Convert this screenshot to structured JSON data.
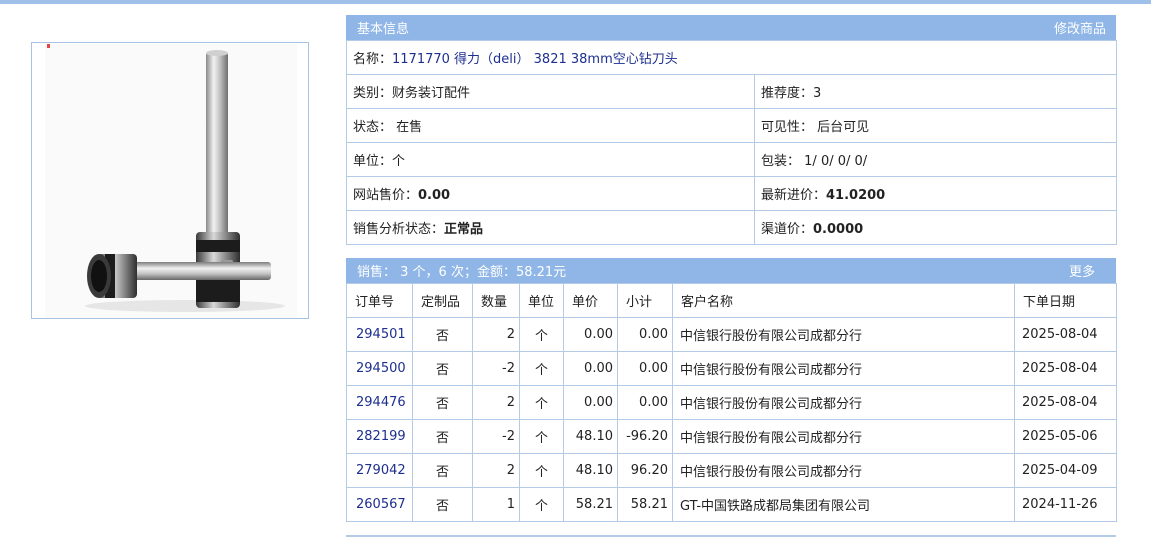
{
  "info": {
    "title": "基本信息",
    "edit_label": "修改商品",
    "name_label": "名称：",
    "name_value": "1171770 得力（deli） 3821 38mm空心钻刀头",
    "category_label": "类别：",
    "category_value": "财务装订配件",
    "recommend_label": "推荐度：",
    "recommend_value": "3",
    "status_label": "状态：",
    "status_value": "在售",
    "visibility_label": "可见性：",
    "visibility_value": "后台可见",
    "unit_label": "单位：",
    "unit_value": "个",
    "package_label": "包装：",
    "package_value": "1/ 0/ 0/ 0/",
    "site_price_label": "网站售价：",
    "site_price_value": "0.00",
    "latest_cost_label": "最新进价：",
    "latest_cost_value": "41.0200",
    "sales_status_label": "销售分析状态：",
    "sales_status_value": "正常品",
    "channel_price_label": "渠道价：",
    "channel_price_value": "0.0000"
  },
  "sales": {
    "summary": "销售： 3 个，6 次；金额：58.21元",
    "more_label": "更多",
    "headers": [
      "订单号",
      "定制品",
      "数量",
      "单位",
      "单价",
      "小计",
      "客户名称",
      "下单日期"
    ],
    "rows": [
      {
        "order": "294501",
        "custom": "否",
        "qty": "2",
        "unit": "个",
        "price": "0.00",
        "subtotal": "0.00",
        "customer": "中信银行股份有限公司成都分行",
        "date": "2025-08-04"
      },
      {
        "order": "294500",
        "custom": "否",
        "qty": "-2",
        "unit": "个",
        "price": "0.00",
        "subtotal": "0.00",
        "customer": "中信银行股份有限公司成都分行",
        "date": "2025-08-04"
      },
      {
        "order": "294476",
        "custom": "否",
        "qty": "2",
        "unit": "个",
        "price": "0.00",
        "subtotal": "0.00",
        "customer": "中信银行股份有限公司成都分行",
        "date": "2025-08-04"
      },
      {
        "order": "282199",
        "custom": "否",
        "qty": "-2",
        "unit": "个",
        "price": "48.10",
        "subtotal": "-96.20",
        "customer": "中信银行股份有限公司成都分行",
        "date": "2025-05-06"
      },
      {
        "order": "279042",
        "custom": "否",
        "qty": "2",
        "unit": "个",
        "price": "48.10",
        "subtotal": "96.20",
        "customer": "中信银行股份有限公司成都分行",
        "date": "2025-04-09"
      },
      {
        "order": "260567",
        "custom": "否",
        "qty": "1",
        "unit": "个",
        "price": "58.21",
        "subtotal": "58.21",
        "customer": "GT-中国铁路成都局集团有限公司",
        "date": "2024-11-26"
      }
    ]
  },
  "colors": {
    "header_bg": "#8fb6e6",
    "link": "#1d2f8f",
    "border": "#b3cbe6"
  }
}
